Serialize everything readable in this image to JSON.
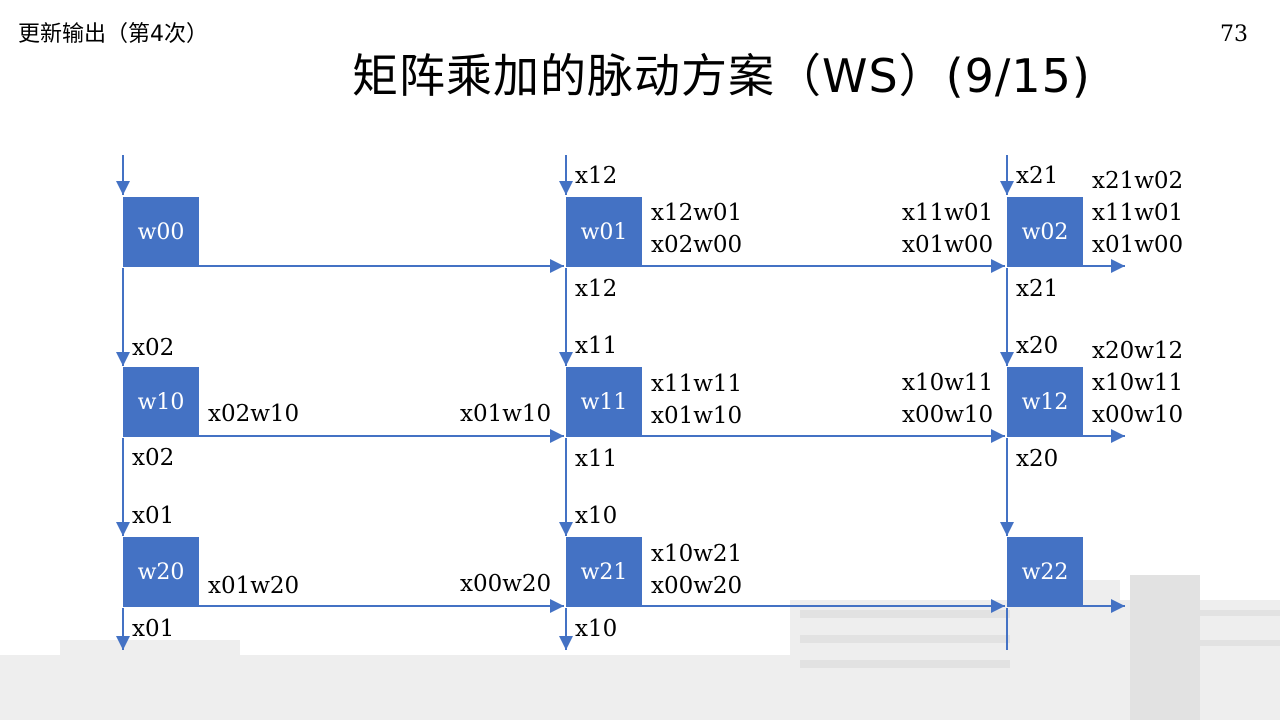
{
  "header": {
    "corner_label": "更新输出（第4次）",
    "page_number": "73",
    "title": "矩阵乘加的脉动方案（WS）(9/15)"
  },
  "colors": {
    "pe_fill": "#4472C4",
    "arrow": "#4472C4",
    "pe_text": "#FFFFFF"
  },
  "pe_grid": [
    [
      "w00",
      "w01",
      "w02"
    ],
    [
      "w10",
      "w11",
      "w12"
    ],
    [
      "w20",
      "w21",
      "w22"
    ]
  ],
  "labels": {
    "col0": {
      "in1": "x02",
      "out1": "x02",
      "in2": "x01",
      "out2": "x01"
    },
    "col1": {
      "in0": "x12",
      "out0": "x12",
      "in1": "x11",
      "out1": "x11",
      "in2": "x10",
      "out2": "x10"
    },
    "col2": {
      "in0": "x21",
      "out0": "x21",
      "in1": "x20",
      "out1": "x20"
    },
    "r1c0_right": "x02w10",
    "r1c1_left": "x01w10",
    "r2c0_right": "x01w20",
    "r2c1_left": "x00w20",
    "r0c1_right": [
      "x12w01",
      "x02w00"
    ],
    "r1c1_right": [
      "x11w11",
      "x01w10"
    ],
    "r2c1_right": [
      "x10w21",
      "x00w20"
    ],
    "r0c2_left": [
      "x11w01",
      "x01w00"
    ],
    "r1c2_left": [
      "x10w11",
      "x00w10"
    ],
    "r0_out": [
      "x21w02",
      "x11w01",
      "x01w00"
    ],
    "r1_out": [
      "x20w12",
      "x10w11",
      "x00w10"
    ]
  }
}
